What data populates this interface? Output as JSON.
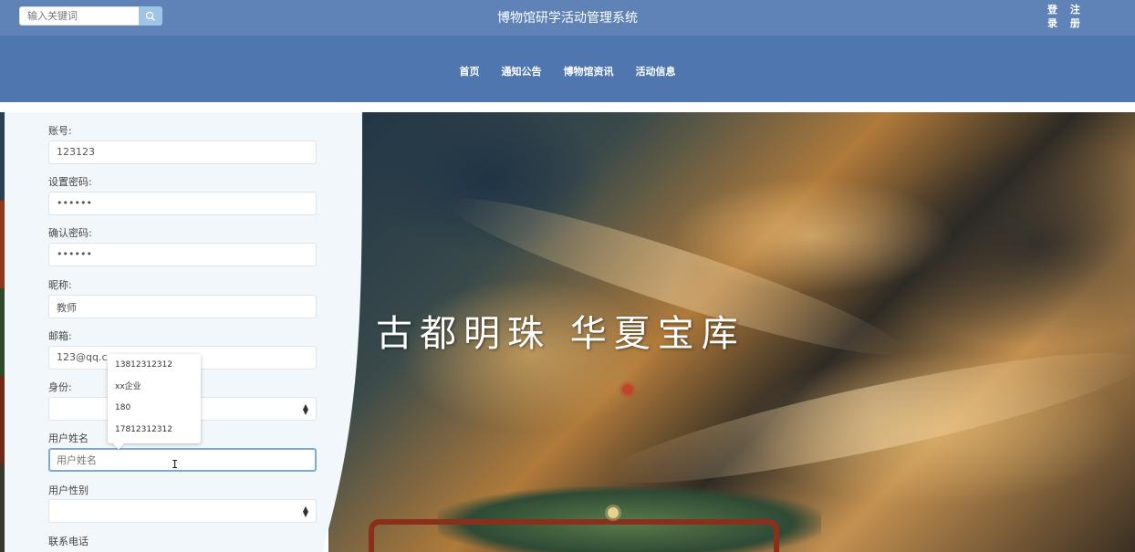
{
  "header": {
    "search_placeholder": "输入关键词",
    "site_title": "博物馆研学活动管理系统",
    "auth_line1": "登 注",
    "auth_line2": "录 册"
  },
  "nav": {
    "items": [
      "首页",
      "通知公告",
      "博物馆资讯",
      "活动信息"
    ]
  },
  "hero": {
    "slogan": "古都明珠  华夏宝库"
  },
  "form": {
    "account_label": "账号:",
    "account_value": "123123",
    "password_label": "设置密码:",
    "password_value": "••••••",
    "confirm_label": "确认密码:",
    "confirm_value": "••••••",
    "nickname_label": "昵称:",
    "nickname_value": "教师",
    "email_label": "邮箱:",
    "email_value": "123@qq.com",
    "identity_label": "身份:",
    "identity_value": "",
    "username_label": "用户姓名",
    "username_placeholder": "用户姓名",
    "gender_label": "用户性别",
    "gender_value": "",
    "phone_label": "联系电话"
  },
  "autocomplete": {
    "options": [
      "13812312312",
      "xx企业",
      "180",
      "17812312312"
    ]
  },
  "icons": {
    "search": "search-icon",
    "select_arrow": "sort-arrows-icon"
  }
}
